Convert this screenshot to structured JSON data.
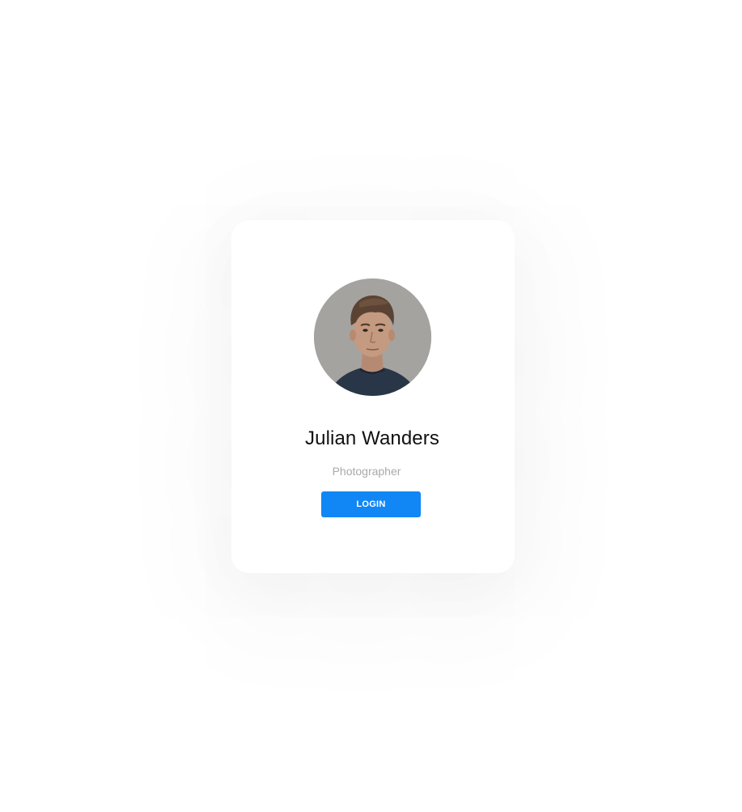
{
  "profile": {
    "name": "Julian Wanders",
    "role": "Photographer",
    "login_label": "LOGIN"
  },
  "colors": {
    "button": "#1187f6",
    "name_text": "#111111",
    "role_text": "#a9a9a9",
    "background": "#ffffff"
  }
}
